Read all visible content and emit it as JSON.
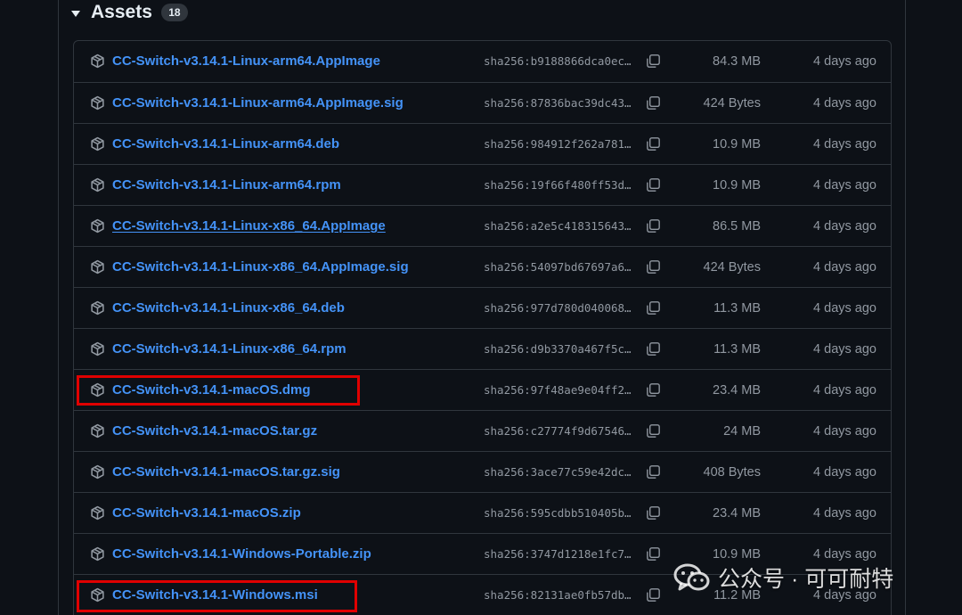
{
  "assets": {
    "title": "Assets",
    "count": "18",
    "rows": [
      {
        "name": "CC-Switch-v3.14.1-Linux-arm64.AppImage",
        "sha": "sha256:b9188866dca0ec…",
        "size": "84.3 MB",
        "date": "4 days ago",
        "icon": "package-icon"
      },
      {
        "name": "CC-Switch-v3.14.1-Linux-arm64.AppImage.sig",
        "sha": "sha256:87836bac39dc43…",
        "size": "424 Bytes",
        "date": "4 days ago",
        "icon": "package-icon"
      },
      {
        "name": "CC-Switch-v3.14.1-Linux-arm64.deb",
        "sha": "sha256:984912f262a781…",
        "size": "10.9 MB",
        "date": "4 days ago",
        "icon": "package-icon"
      },
      {
        "name": "CC-Switch-v3.14.1-Linux-arm64.rpm",
        "sha": "sha256:19f66f480ff53d…",
        "size": "10.9 MB",
        "date": "4 days ago",
        "icon": "package-icon"
      },
      {
        "name": "CC-Switch-v3.14.1-Linux-x86_64.AppImage",
        "sha": "sha256:a2e5c418315643…",
        "size": "86.5 MB",
        "date": "4 days ago",
        "icon": "package-icon"
      },
      {
        "name": "CC-Switch-v3.14.1-Linux-x86_64.AppImage.sig",
        "sha": "sha256:54097bd67697a6…",
        "size": "424 Bytes",
        "date": "4 days ago",
        "icon": "package-icon"
      },
      {
        "name": "CC-Switch-v3.14.1-Linux-x86_64.deb",
        "sha": "sha256:977d780d040068…",
        "size": "11.3 MB",
        "date": "4 days ago",
        "icon": "package-icon"
      },
      {
        "name": "CC-Switch-v3.14.1-Linux-x86_64.rpm",
        "sha": "sha256:d9b3370a467f5c…",
        "size": "11.3 MB",
        "date": "4 days ago",
        "icon": "package-icon"
      },
      {
        "name": "CC-Switch-v3.14.1-macOS.dmg",
        "sha": "sha256:97f48ae9e04ff2…",
        "size": "23.4 MB",
        "date": "4 days ago",
        "icon": "package-icon"
      },
      {
        "name": "CC-Switch-v3.14.1-macOS.tar.gz",
        "sha": "sha256:c27774f9d67546…",
        "size": "24 MB",
        "date": "4 days ago",
        "icon": "package-icon"
      },
      {
        "name": "CC-Switch-v3.14.1-macOS.tar.gz.sig",
        "sha": "sha256:3ace77c59e42dc…",
        "size": "408 Bytes",
        "date": "4 days ago",
        "icon": "package-icon"
      },
      {
        "name": "CC-Switch-v3.14.1-macOS.zip",
        "sha": "sha256:595cdbb510405b…",
        "size": "23.4 MB",
        "date": "4 days ago",
        "icon": "package-icon"
      },
      {
        "name": "CC-Switch-v3.14.1-Windows-Portable.zip",
        "sha": "sha256:3747d1218e1fc7…",
        "size": "10.9 MB",
        "date": "4 days ago",
        "icon": "package-icon"
      },
      {
        "name": "CC-Switch-v3.14.1-Windows.msi",
        "sha": "sha256:82131ae0fb57db…",
        "size": "11.2 MB",
        "date": "4 days ago",
        "icon": "package-icon"
      }
    ]
  },
  "watermark": {
    "text": "公众号 · 可可耐特",
    "icon": "wechat-icon"
  },
  "colors": {
    "background": "#0d1117",
    "border": "#30363d",
    "link": "#4493f8",
    "muted": "#9198a1",
    "highlight": "#e00000"
  }
}
